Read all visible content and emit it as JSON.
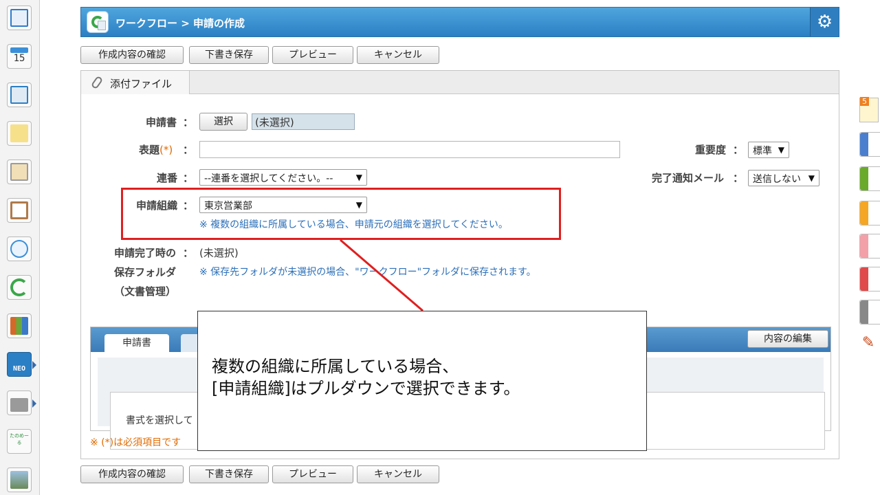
{
  "sidebar": {
    "apps": [
      {
        "name": "portal-icon",
        "color": "#2e7bc9"
      },
      {
        "name": "calendar-icon",
        "label": "15",
        "color": "#3a8fd8"
      },
      {
        "name": "facility-icon",
        "color": "#2b7fc4"
      },
      {
        "name": "memo-icon",
        "color": "#f2c94c"
      },
      {
        "name": "bulletin-icon",
        "color": "#d8a64a"
      },
      {
        "name": "clipboard-icon",
        "color": "#b07a4a"
      },
      {
        "name": "search-doc-icon",
        "color": "#3a8fd8"
      },
      {
        "name": "workflow-icon",
        "color": "#3aa74a"
      },
      {
        "name": "cabinet-icon",
        "color": "#d46a2a"
      },
      {
        "name": "neo-icon",
        "label": "NEO",
        "color": "#2b7fc4"
      },
      {
        "name": "folder-icon",
        "color": "#8a8a8a"
      },
      {
        "name": "tanomeru-icon",
        "label": "たのめーる",
        "color": "#2a8a3a"
      },
      {
        "name": "photo-icon",
        "color": "#6a8aaa"
      }
    ]
  },
  "right_strip": {
    "badge": "5",
    "tabs": [
      {
        "name": "blue-tab",
        "color": "#4a7fd0"
      },
      {
        "name": "green-tab",
        "color": "#6aaa2a"
      },
      {
        "name": "orange-tab",
        "color": "#f5a623"
      },
      {
        "name": "pink-tab",
        "color": "#f4a0a8"
      },
      {
        "name": "red-tab",
        "color": "#e04a4a"
      },
      {
        "name": "gray-tab",
        "color": "#888888"
      }
    ]
  },
  "header": {
    "title": "ワークフロー > 申請の作成",
    "bg_color": "#2b7fc4"
  },
  "toolbar": {
    "confirm": "作成内容の確認",
    "draft": "下書き保存",
    "preview": "プレビュー",
    "cancel": "キャンセル"
  },
  "attach": {
    "label": "添付ファイル"
  },
  "form": {
    "form_label": "申請書",
    "select_btn": "選択",
    "form_value": "(未選択)",
    "subject_label": "表題",
    "required_mark": "(*)",
    "colon": "：",
    "serial_label": "連番",
    "serial_value": "--連番を選択してください。--",
    "org_label": "申請組織",
    "org_value": "東京営業部",
    "org_note": "※ 複数の組織に所属している場合、申請元の組織を選択してください。",
    "complete_label": "申請完了時の",
    "complete_value": "(未選択)",
    "folder_label": "保存フォルダ",
    "folder_label2": "（文書管理）",
    "folder_note": "※ 保存先フォルダが未選択の場合、\"ワークフロー\"フォルダに保存されます。",
    "priority_label": "重要度",
    "priority_value": "標準",
    "mail_label": "完了通知メール",
    "mail_value": "送信しない"
  },
  "editor": {
    "tab_label": "申請書",
    "edit_btn": "内容の編集",
    "placeholder": "書式を選択して",
    "required_note": "※ (*)は必須項目です"
  },
  "callout": {
    "line1": "複数の組織に所属している場合、",
    "line2": "[申請組織]はプルダウンで選択できます。",
    "border_color": "#e01f1f"
  }
}
